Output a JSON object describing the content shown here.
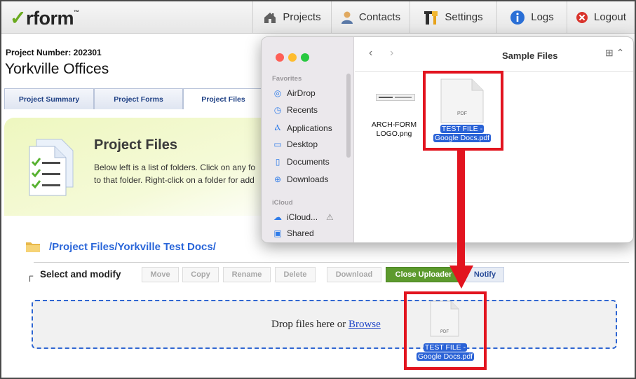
{
  "app": {
    "logo_text": "rform",
    "logo_tm": "™"
  },
  "nav": {
    "items": [
      {
        "label": "Projects",
        "icon": "house-icon"
      },
      {
        "label": "Contacts",
        "icon": "person-icon"
      },
      {
        "label": "Settings",
        "icon": "tools-icon"
      },
      {
        "label": "Logs",
        "icon": "info-icon"
      },
      {
        "label": "Logout",
        "icon": "close-circle-icon"
      }
    ]
  },
  "project": {
    "number_label": "Project Number: 202301",
    "name": "Yorkville Offices"
  },
  "tabs": [
    {
      "label": "Project Summary",
      "active": false
    },
    {
      "label": "Project Forms",
      "active": false
    },
    {
      "label": "Project Files",
      "active": true
    }
  ],
  "banner": {
    "title": "Project Files",
    "desc_line1": "Below left is a list of folders. Click on any fo",
    "desc_line2": "to that folder. Right-click on a folder for add"
  },
  "path": {
    "text": "/Project Files/Yorkville Test Docs/"
  },
  "toolbar": {
    "select_label": "Select and modify",
    "buttons": [
      {
        "label": "Move",
        "enabled": false
      },
      {
        "label": "Copy",
        "enabled": false
      },
      {
        "label": "Rename",
        "enabled": false
      },
      {
        "label": "Delete",
        "enabled": false
      },
      {
        "label": "Download",
        "enabled": false
      },
      {
        "label": "Close Uploader",
        "enabled": true
      },
      {
        "label": "Notify",
        "enabled": true
      }
    ]
  },
  "dropzone": {
    "text": "Drop files here or ",
    "browse_label": "Browse"
  },
  "finder": {
    "title": "Sample Files",
    "sidebar": {
      "favorites_heading": "Favorites",
      "favorites": [
        {
          "label": "AirDrop",
          "icon": "airdrop-icon"
        },
        {
          "label": "Recents",
          "icon": "clock-icon"
        },
        {
          "label": "Applications",
          "icon": "applications-icon"
        },
        {
          "label": "Desktop",
          "icon": "desktop-icon"
        },
        {
          "label": "Documents",
          "icon": "document-icon"
        },
        {
          "label": "Downloads",
          "icon": "download-icon"
        }
      ],
      "icloud_heading": "iCloud",
      "icloud": [
        {
          "label": "iCloud...",
          "icon": "cloud-icon"
        },
        {
          "label": "Shared",
          "icon": "shared-folder-icon"
        }
      ]
    },
    "files": [
      {
        "name_line1": "ARCH-FORM",
        "name_line2": "LOGO.png",
        "selected": false
      },
      {
        "name_line1": "TEST FILE -",
        "name_line2": "Google Docs.pdf",
        "selected": true,
        "badge": "PDF"
      }
    ]
  },
  "dragged_file": {
    "name_line1": "TEST FILE -",
    "name_line2": "Google Docs.pdf",
    "badge": "PDF"
  },
  "colors": {
    "highlight_red": "#e2141f",
    "accent_green": "#5c9a2d",
    "link_blue": "#2a66d9",
    "selection_blue": "#2a62d6"
  }
}
